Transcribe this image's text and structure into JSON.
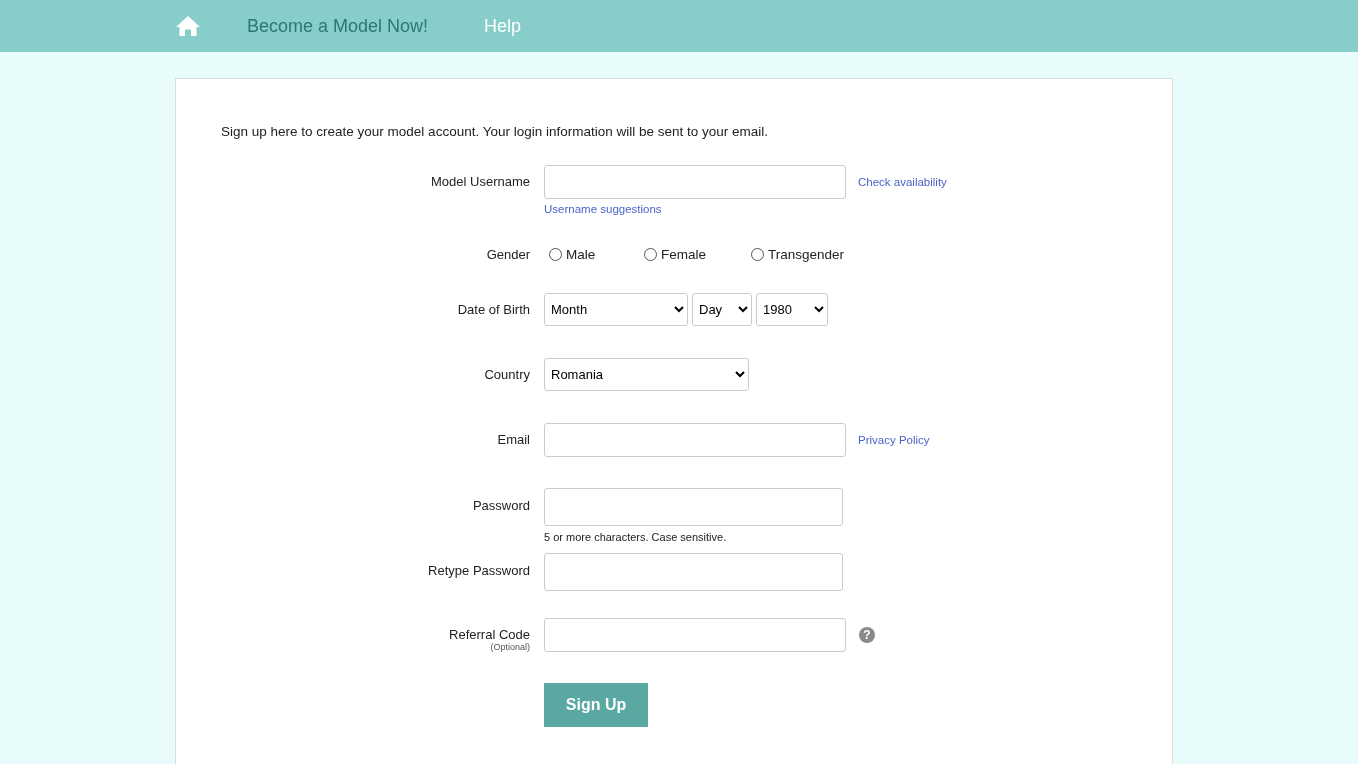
{
  "nav": {
    "items": [
      {
        "kind": "home"
      },
      {
        "kind": "link",
        "label": "Become a Model Now!",
        "selected": true
      },
      {
        "kind": "link",
        "label": "Help",
        "selected": false
      }
    ]
  },
  "intro": "Sign up here to create your model account. Your login information will be sent to your email.",
  "rows": [
    {
      "kind": "text",
      "label": "Model Username",
      "value": "",
      "side_link": "Check availability",
      "below_link": "Username suggestions"
    },
    {
      "kind": "radio",
      "label": "Gender",
      "options": [
        {
          "label": "Male",
          "selected": false
        },
        {
          "label": "Female",
          "selected": false
        },
        {
          "label": "Transgender",
          "selected": false
        }
      ]
    },
    {
      "kind": "selects",
      "label": "Date of Birth",
      "selects": [
        {
          "value": "Month"
        },
        {
          "value": "Day"
        },
        {
          "value": "1980"
        }
      ]
    },
    {
      "kind": "selects",
      "label": "Country",
      "selects": [
        {
          "value": "Romania"
        }
      ]
    },
    {
      "kind": "text",
      "label": "Email",
      "value": "",
      "side_link": "Privacy Policy"
    },
    {
      "kind": "password",
      "label": "Password",
      "value": "",
      "hint": "5 or more characters. Case sensitive."
    },
    {
      "kind": "password",
      "label": "Retype Password",
      "value": ""
    },
    {
      "kind": "text",
      "label": "Referral Code",
      "sublabel": "(Optional)",
      "value": "",
      "help_icon": "?"
    }
  ],
  "submit": "Sign Up"
}
